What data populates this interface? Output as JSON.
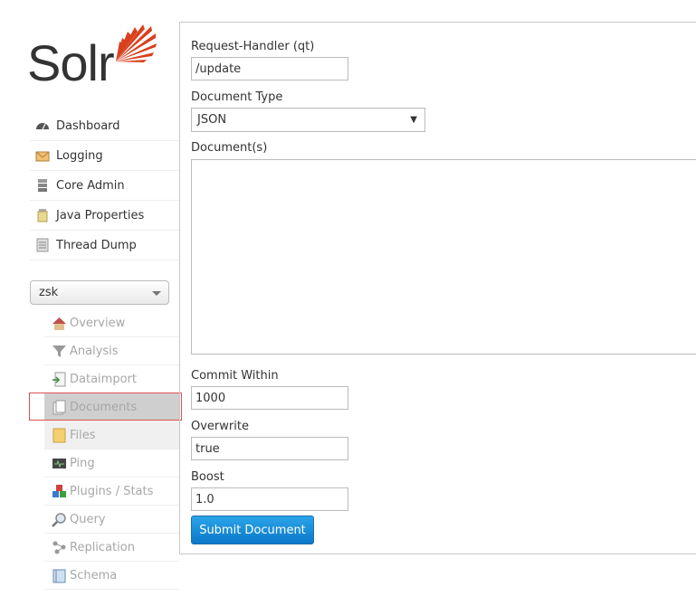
{
  "logo": {
    "text": "Solr"
  },
  "nav": {
    "items": [
      {
        "label": "Dashboard",
        "icon": "dashboard-icon"
      },
      {
        "label": "Logging",
        "icon": "logging-icon"
      },
      {
        "label": "Core Admin",
        "icon": "core-admin-icon"
      },
      {
        "label": "Java Properties",
        "icon": "java-properties-icon"
      },
      {
        "label": "Thread Dump",
        "icon": "thread-dump-icon"
      }
    ]
  },
  "core_selector": {
    "value": "zsk"
  },
  "core_menu": {
    "items": [
      {
        "label": "Overview",
        "icon": "overview-icon"
      },
      {
        "label": "Analysis",
        "icon": "analysis-icon"
      },
      {
        "label": "Dataimport",
        "icon": "dataimport-icon"
      },
      {
        "label": "Documents",
        "icon": "documents-icon",
        "active": true
      },
      {
        "label": "Files",
        "icon": "files-icon"
      },
      {
        "label": "Ping",
        "icon": "ping-icon"
      },
      {
        "label": "Plugins / Stats",
        "icon": "plugins-icon"
      },
      {
        "label": "Query",
        "icon": "query-icon"
      },
      {
        "label": "Replication",
        "icon": "replication-icon"
      },
      {
        "label": "Schema",
        "icon": "schema-icon"
      }
    ]
  },
  "form": {
    "request_handler_label": "Request-Handler (qt)",
    "request_handler_value": "/update",
    "document_type_label": "Document Type",
    "document_type_value": "JSON",
    "documents_label": "Document(s)",
    "commit_within_label": "Commit Within",
    "commit_within_value": "1000",
    "overwrite_label": "Overwrite",
    "overwrite_value": "true",
    "boost_label": "Boost",
    "boost_value": "1.0",
    "submit_label": "Submit Document"
  },
  "colors": {
    "accent": "#0a78c7",
    "logo_sun": "#d9411e",
    "highlight": "#e05050"
  }
}
